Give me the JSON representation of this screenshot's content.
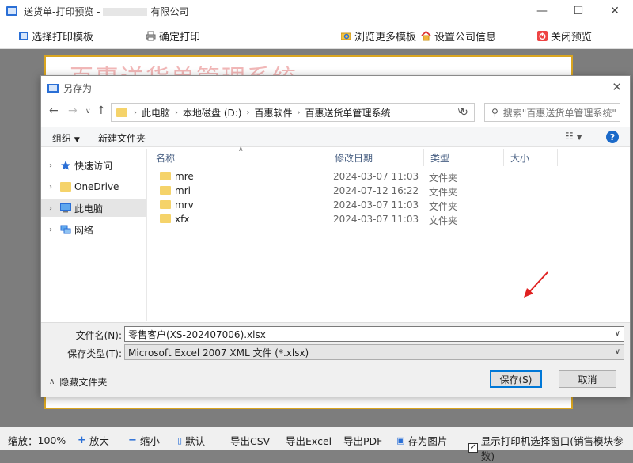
{
  "app": {
    "title_prefix": "送货单-打印预览 -",
    "title_suffix": "有限公司",
    "window_controls": {
      "min": "—",
      "max": "☐",
      "close": "✕"
    }
  },
  "toolbar": {
    "select_template": "选择打印模板",
    "confirm_print": "确定打印",
    "browse_templates": "浏览更多模板",
    "company_info": "设置公司信息",
    "close_preview": "关闭预览"
  },
  "preview": {
    "watermark": "百惠送货单管理系统"
  },
  "dialog": {
    "title": "另存为",
    "address": {
      "crumbs": [
        "此电脑",
        "本地磁盘 (D:)",
        "百惠软件",
        "百惠送货单管理系统"
      ]
    },
    "search_placeholder": "搜索\"百惠送货单管理系统\"",
    "commands": {
      "organize": "组织",
      "new_folder": "新建文件夹"
    },
    "nav_items": [
      {
        "label": "快速访问",
        "icon": "star-icon"
      },
      {
        "label": "OneDrive",
        "icon": "folder-icon"
      },
      {
        "label": "此电脑",
        "icon": "computer-icon",
        "selected": true
      },
      {
        "label": "网络",
        "icon": "network-icon"
      }
    ],
    "columns": {
      "name": "名称",
      "date": "修改日期",
      "type": "类型",
      "size": "大小"
    },
    "files": [
      {
        "name": "mre",
        "date": "2024-03-07 11:03",
        "type": "文件夹"
      },
      {
        "name": "mri",
        "date": "2024-07-12 16:22",
        "type": "文件夹"
      },
      {
        "name": "mrv",
        "date": "2024-03-07 11:03",
        "type": "文件夹"
      },
      {
        "name": "xfx",
        "date": "2024-03-07 11:03",
        "type": "文件夹"
      }
    ],
    "filename_label": "文件名(N):",
    "filename_value": "零售客户(XS-202407006).xlsx",
    "filetype_label": "保存类型(T):",
    "filetype_value": "Microsoft Excel 2007 XML 文件 (*.xlsx)",
    "hide_folders": "隐藏文件夹",
    "save_button": "保存(S)",
    "cancel_button": "取消"
  },
  "statusbar": {
    "zoom_label": "缩放：",
    "zoom_value": "100%",
    "zoom_in": "放大",
    "zoom_out": "缩小",
    "default": "默认",
    "export_csv": "导出CSV",
    "export_excel": "导出Excel",
    "export_pdf": "导出PDF",
    "save_image": "存为图片",
    "show_printer_dialog": "显示打印机选择窗口(销售模块参数)",
    "show_printer_dialog_checked": true
  },
  "colors": {
    "accent": "#0078d7",
    "arrow": "#e02020",
    "paper_border": "#d9a520",
    "folder": "#f5d36a"
  }
}
